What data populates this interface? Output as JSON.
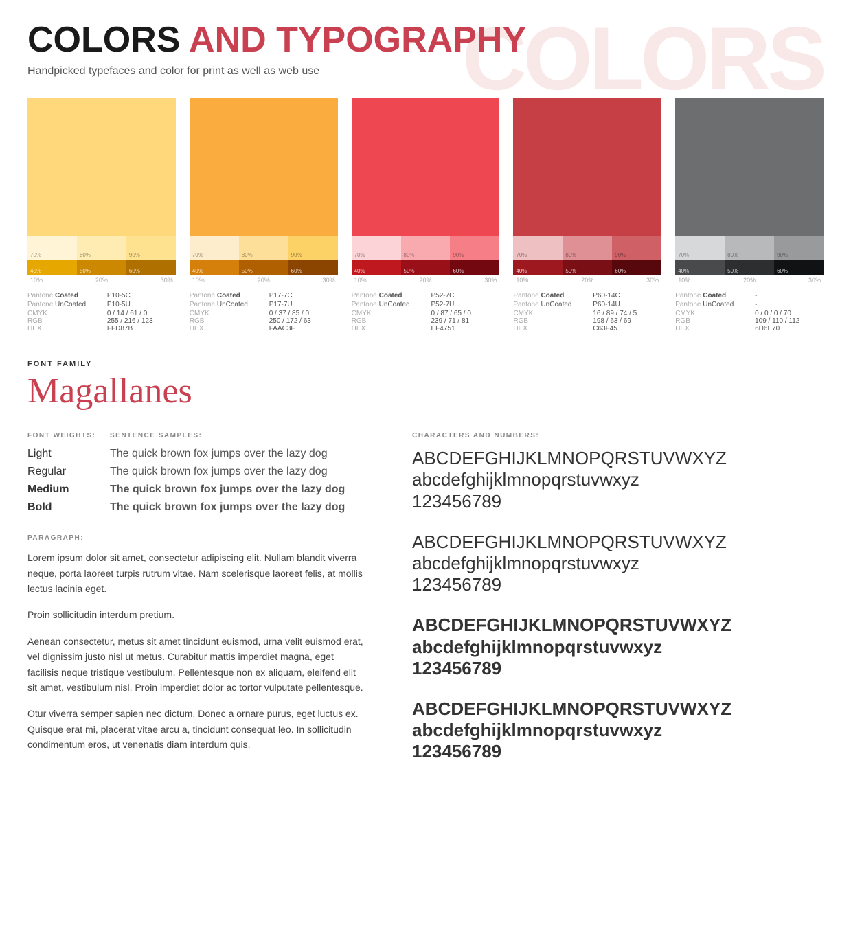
{
  "header": {
    "title_black": "COLORS",
    "title_red": "AND TYPOGRAPHY",
    "watermark": "COLORS",
    "subtitle": "Handpicked typefaces and color for print as well as web use"
  },
  "swatches": [
    {
      "id": "yellow",
      "main_color": "#FFD87B",
      "tints": [
        "#FFF5D6",
        "#FFECB3",
        "#FFE28F"
      ],
      "tint_labels": [
        "70%",
        "80%",
        "90%"
      ],
      "shades": [
        "#E6B800",
        "#CC9900"
      ],
      "shade_labels": [
        "40%",
        "50%",
        "60%"
      ],
      "row_labels_top": [
        "40%",
        "50%",
        "60%"
      ],
      "row_labels_bot": [
        "10%",
        "20%",
        "30%"
      ],
      "pantone_coated": "P10-5C",
      "pantone_uncoated": "P10-5U",
      "cmyk": "0 / 14 / 61 / 0",
      "rgb": "255 / 216 / 123",
      "hex": "FFD87B"
    },
    {
      "id": "orange",
      "main_color": "#FAAC3F",
      "tints": [
        "#FEEFD0",
        "#FDDFA0",
        "#FCD070"
      ],
      "tint_labels": [
        "70%",
        "80%",
        "90%"
      ],
      "shades": [
        "#D4800A",
        "#B06000"
      ],
      "shade_labels": [
        "40%",
        "50%",
        "60%"
      ],
      "row_labels_top": [
        "40%",
        "50%",
        "60%"
      ],
      "row_labels_bot": [
        "10%",
        "20%",
        "30%"
      ],
      "pantone_coated": "P17-7C",
      "pantone_uncoated": "P17-7U",
      "cmyk": "0 / 37 / 85 / 0",
      "rgb": "250 / 172 / 63",
      "hex": "FAAC3F"
    },
    {
      "id": "red",
      "main_color": "#EF4751",
      "tints": [
        "#FCD5D7",
        "#F9ABAF",
        "#F68087"
      ],
      "tint_labels": [
        "70%",
        "80%",
        "90%"
      ],
      "shades": [
        "#C01820",
        "#9A1018"
      ],
      "shade_labels": [
        "40%",
        "50%",
        "60%"
      ],
      "row_labels_top": [
        "40%",
        "50%",
        "60%"
      ],
      "row_labels_bot": [
        "10%",
        "20%",
        "30%"
      ],
      "pantone_coated": "P52-7C",
      "pantone_uncoated": "P52-7U",
      "cmyk": "0 / 87 / 65 / 0",
      "rgb": "239 / 71 / 81",
      "hex": "EF4751"
    },
    {
      "id": "dark_red",
      "main_color": "#C63F45",
      "tints": [
        "#F0C4C6",
        "#E09095",
        "#D06065"
      ],
      "tint_labels": [
        "70%",
        "80%",
        "90%"
      ],
      "shades": [
        "#A01820",
        "#801018"
      ],
      "shade_labels": [
        "40%",
        "50%",
        "60%"
      ],
      "row_labels_top": [
        "40%",
        "50%",
        "60%"
      ],
      "row_labels_bot": [
        "10%",
        "20%",
        "30%"
      ],
      "pantone_coated": "P60-14C",
      "pantone_uncoated": "P60-14U",
      "cmyk": "16 / 89 / 74 / 5",
      "rgb": "198 / 63 / 69",
      "hex": "C63F45"
    },
    {
      "id": "gray",
      "main_color": "#6D6E70",
      "tints": [
        "#D8D9DA",
        "#B8B9BB",
        "#989A9C"
      ],
      "tint_labels": [
        "70%",
        "80%",
        "90%"
      ],
      "shades": [
        "#484A4C",
        "#282A2C"
      ],
      "shade_labels": [
        "40%",
        "50%",
        "60%"
      ],
      "row_labels_top": [
        "40%",
        "50%",
        "60%"
      ],
      "row_labels_bot": [
        "10%",
        "20%",
        "30%"
      ],
      "pantone_coated": "-",
      "pantone_uncoated": "-",
      "cmyk": "0 / 0 / 0 / 70",
      "rgb": "109 / 110 / 112",
      "hex": "6D6E70"
    }
  ],
  "font": {
    "family_label": "FONT FAMILY",
    "family_name": "Magallanes",
    "weights_label": "FONT WEIGHTS:",
    "sentence_label": "SENTENCE SAMPLES:",
    "chars_label": "CHARACTERS AND NUMBERS:",
    "paragraph_label": "PARAGRAPH:",
    "weights": [
      {
        "name": "Light",
        "sample": "The quick brown fox jumps over the lazy dog",
        "class": "w-light"
      },
      {
        "name": "Regular",
        "sample": "The quick brown fox jumps over the lazy dog",
        "class": "w-regular"
      },
      {
        "name": "Medium",
        "sample": "The quick brown fox jumps over the lazy dog",
        "class": "w-medium"
      },
      {
        "name": "Bold",
        "sample": "The quick brown fox jumps over the lazy dog",
        "class": "w-bold"
      }
    ],
    "paragraph1": "Lorem ipsum dolor sit amet, consectetur adipiscing elit. Nullam blandit viverra neque, porta laoreet turpis rutrum vitae. Nam scelerisque laoreet felis, at mollis lectus lacinia eget.",
    "paragraph2": "Proin sollicitudin interdum pretium.",
    "paragraph3": "Aenean consectetur, metus sit amet tincidunt euismod, urna velit euismod erat, vel dignissim justo nisl ut metus. Curabitur mattis imperdiet magna, eget facilisis neque tristique vestibulum. Pellentesque non ex aliquam, eleifend elit sit amet, vestibulum nisl. Proin imperdiet dolor ac tortor vulputate pellentesque.",
    "paragraph4": "Otur viverra semper sapien nec dictum. Donec a ornare purus, eget luctus ex. Quisque erat mi, placerat vitae arcu a, tincidunt consequat leo. In sollicitudin condimentum eros, ut venenatis diam interdum quis.",
    "chars_groups": [
      {
        "weight": "light",
        "uppercase": "ABCDEFGHIJKLMNOPQRSTUVWXYZ",
        "lowercase": "abcdefghijklmnopqrstuvwxyz",
        "numbers": "123456789"
      },
      {
        "weight": "regular",
        "uppercase": "ABCDEFGHIJKLMNOPQRSTUVWXYZ",
        "lowercase": "abcdefghijklmnopqrstuvwxyz",
        "numbers": "123456789"
      },
      {
        "weight": "medium",
        "uppercase": "ABCDEFGHIJKLMNOPQRSTUVWXYZ",
        "lowercase": "abcdefghijklmnopqrstuvwxyz",
        "numbers": "123456789"
      },
      {
        "weight": "bold",
        "uppercase": "ABCDEFGHIJKLMNOPQRSTUVWXYZ",
        "lowercase": "abcdefghijklmnopqrstuvwxyz",
        "numbers": "123456789"
      }
    ]
  }
}
